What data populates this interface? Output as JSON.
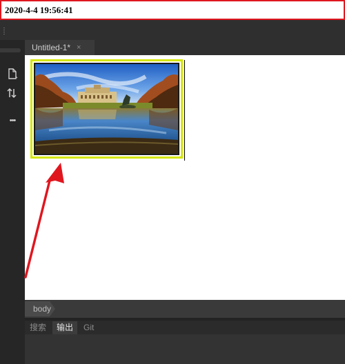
{
  "timestamp": "2020-4-4 19:56:41",
  "editor": {
    "tab_title": "Untitled-1*",
    "tab_close_glyph": "×"
  },
  "sidebar_icons": [
    "new-file-icon",
    "sort-arrows-icon",
    "more-dots-icon"
  ],
  "more_glyph": "•••",
  "breadcrumb": "body",
  "panel_tabs": [
    "搜索",
    "输出",
    "Git"
  ],
  "active_panel_tab": "输出",
  "colors": {
    "annotation_red": "#e0161f",
    "selection_frame": "#d4e600",
    "background": "#2b2b2b"
  }
}
